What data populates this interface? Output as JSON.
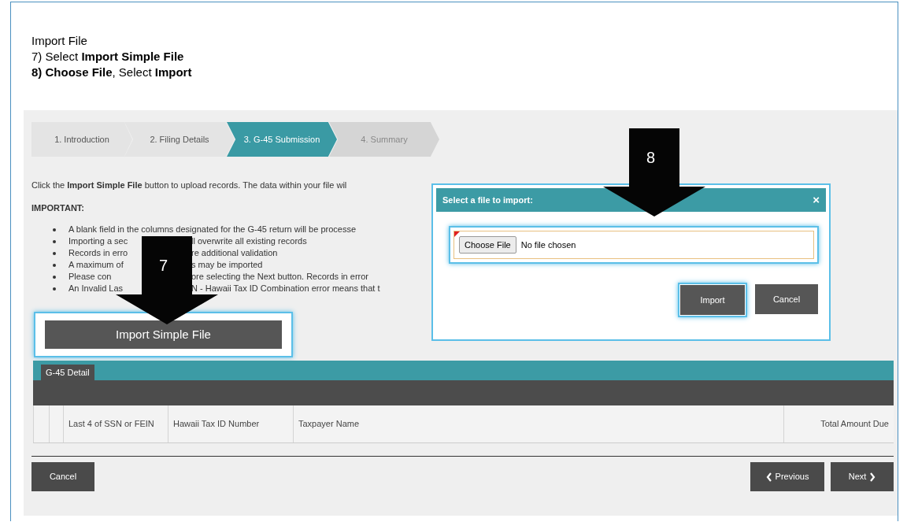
{
  "heading": {
    "title": "Import File",
    "lines": [
      "7) Select **Import Simple File**",
      "**8) Choose File**, Select **Import**"
    ]
  },
  "steps": [
    {
      "label": "1. Introduction",
      "selected": false,
      "disabled": false
    },
    {
      "label": "2. Filing Details",
      "selected": false,
      "disabled": false
    },
    {
      "label": "3. G-45 Submission",
      "selected": true,
      "disabled": false
    },
    {
      "label": "4. Summary",
      "selected": false,
      "disabled": true
    }
  ],
  "intro": "Click the **Import Simple File** button to upload records. The data within your file wil",
  "important_label": "IMPORTANT:",
  "bullets": [
    {
      "parts": [
        "A blank field in the columns designated for the G-45 return will be processe"
      ]
    },
    {
      "parts": [
        "Importing a sec",
        "ll overwrite all existing records"
      ]
    },
    {
      "parts": [
        "Records in erro",
        "re additional validation"
      ]
    },
    {
      "parts": [
        "A maximum of",
        "s may be imported"
      ]
    },
    {
      "parts": [
        "Please con",
        "ore selecting the Next button. Records in error"
      ]
    },
    {
      "parts": [
        "An Invalid Las",
        "N - Hawaii Tax ID Combination error means that t"
      ]
    }
  ],
  "import_button": "Import Simple File",
  "table": {
    "tab": "G-45 Detail",
    "columns": [
      "",
      "",
      "Last 4 of SSN or FEIN",
      "Hawaii Tax ID Number",
      "Taxpayer Name",
      "Total Amount Due"
    ]
  },
  "footer": {
    "cancel": "Cancel",
    "previous": "Previous",
    "next": "Next"
  },
  "dialog": {
    "title": "Select a file to import:",
    "close": "×",
    "choose_button": "Choose File",
    "file_status": "No file chosen",
    "import": "Import",
    "cancel": "Cancel"
  },
  "callouts": [
    {
      "label": "7"
    },
    {
      "label": "8"
    }
  ]
}
